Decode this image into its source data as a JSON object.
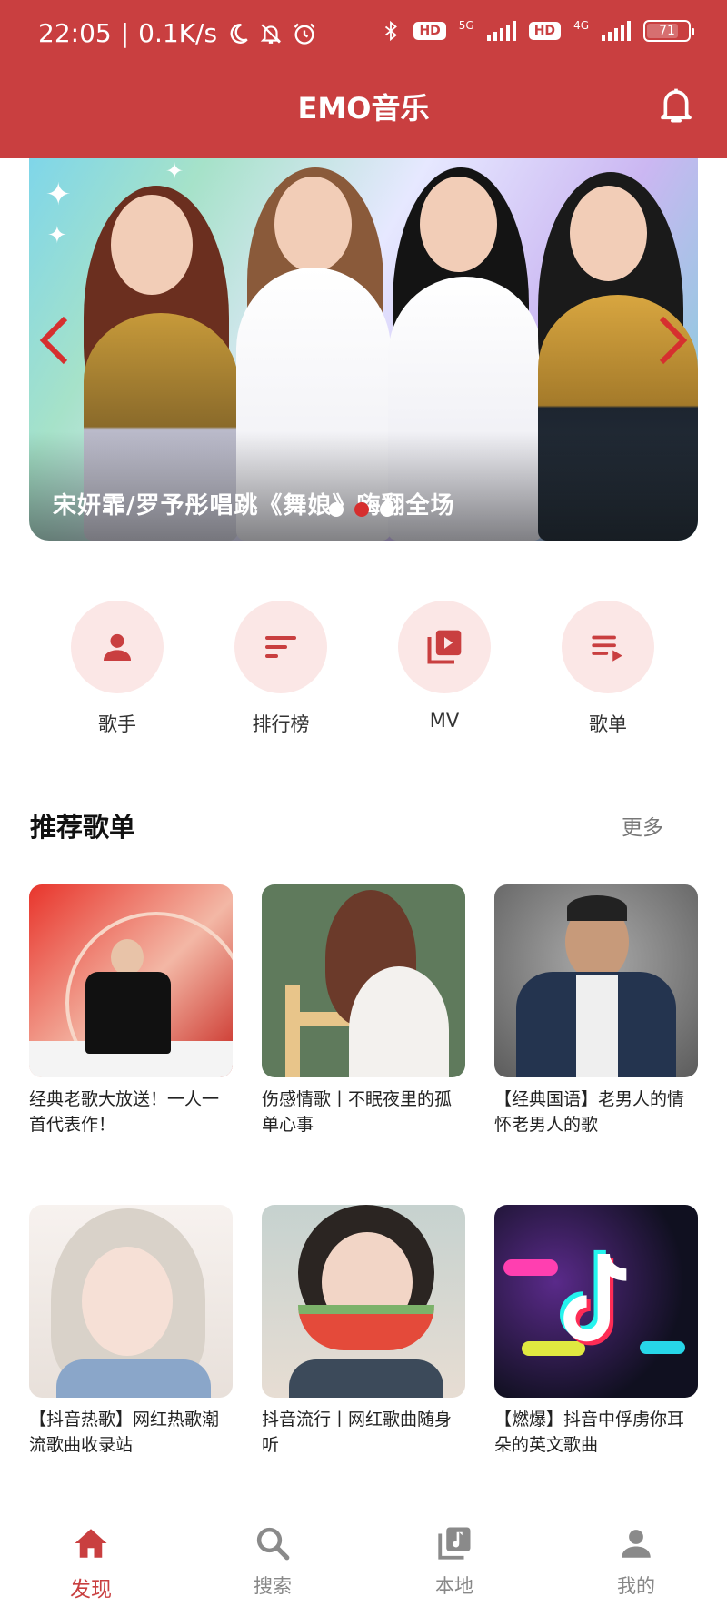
{
  "status_bar": {
    "time": "22:05",
    "separator": "|",
    "speed": "0.1K/s",
    "hd1": "HD",
    "net1": "5G",
    "hd2": "HD",
    "net2": "4G",
    "battery": "71"
  },
  "header": {
    "title": "EMO音乐"
  },
  "banner": {
    "caption": "宋妍霏/罗予彤唱跳《舞娘》嗨翻全场",
    "active_dot": 1
  },
  "quick_actions": [
    {
      "label": "歌手",
      "icon": "person-icon"
    },
    {
      "label": "排行榜",
      "icon": "sort-icon"
    },
    {
      "label": "MV",
      "icon": "video-library-icon"
    },
    {
      "label": "歌单",
      "icon": "playlist-play-icon"
    }
  ],
  "recommended": {
    "title": "推荐歌单",
    "more": "更多",
    "playlists": [
      {
        "title": "经典老歌大放送！一人一首代表作！"
      },
      {
        "title": "伤感情歌丨不眠夜里的孤单心事"
      },
      {
        "title": "【经典国语】老男人的情怀老男人的歌"
      },
      {
        "title": "【抖音热歌】网红热歌潮流歌曲收录站"
      },
      {
        "title": "抖音流行丨网红歌曲随身听"
      },
      {
        "title": "【燃爆】抖音中俘虏你耳朵的英文歌曲"
      }
    ]
  },
  "bottom_nav": [
    {
      "label": "发现",
      "icon": "home-icon",
      "active": true
    },
    {
      "label": "搜索",
      "icon": "search-icon",
      "active": false
    },
    {
      "label": "本地",
      "icon": "music-library-icon",
      "active": false
    },
    {
      "label": "我的",
      "icon": "account-icon",
      "active": false
    }
  ],
  "colors": {
    "primary": "#c93f40",
    "icon_bg": "#fbe7e6",
    "inactive": "#888888"
  }
}
